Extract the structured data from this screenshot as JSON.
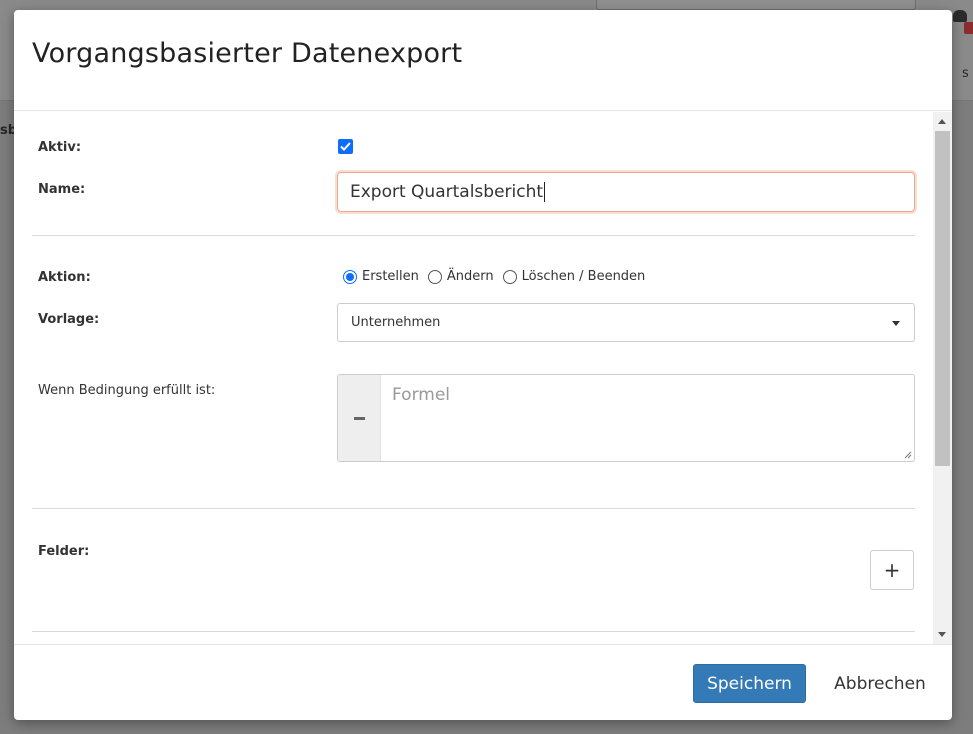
{
  "background": {
    "partial_text_right": "s",
    "partial_text_left": "sb"
  },
  "dialog": {
    "title": "Vorgangsbasierter Datenexport",
    "aktiv": {
      "label": "Aktiv:",
      "checked": true
    },
    "name": {
      "label": "Name:",
      "value": "Export Quartalsbericht"
    },
    "aktion": {
      "label": "Aktion:",
      "options": [
        "Erstellen",
        "Ändern",
        "Löschen / Beenden"
      ],
      "selected": "Erstellen"
    },
    "vorlage": {
      "label": "Vorlage:",
      "value": "Unternehmen"
    },
    "bedingung": {
      "label": "Wenn Bedingung erfüllt ist:",
      "placeholder": "Formel"
    },
    "felder": {
      "label": "Felder:",
      "add_label": "+"
    },
    "footer": {
      "save_label": "Speichern",
      "cancel_label": "Abbrechen"
    }
  },
  "colors": {
    "primary": "#337ab7",
    "checkbox": "#0d6efd",
    "focus_border": "#e9a88f"
  }
}
